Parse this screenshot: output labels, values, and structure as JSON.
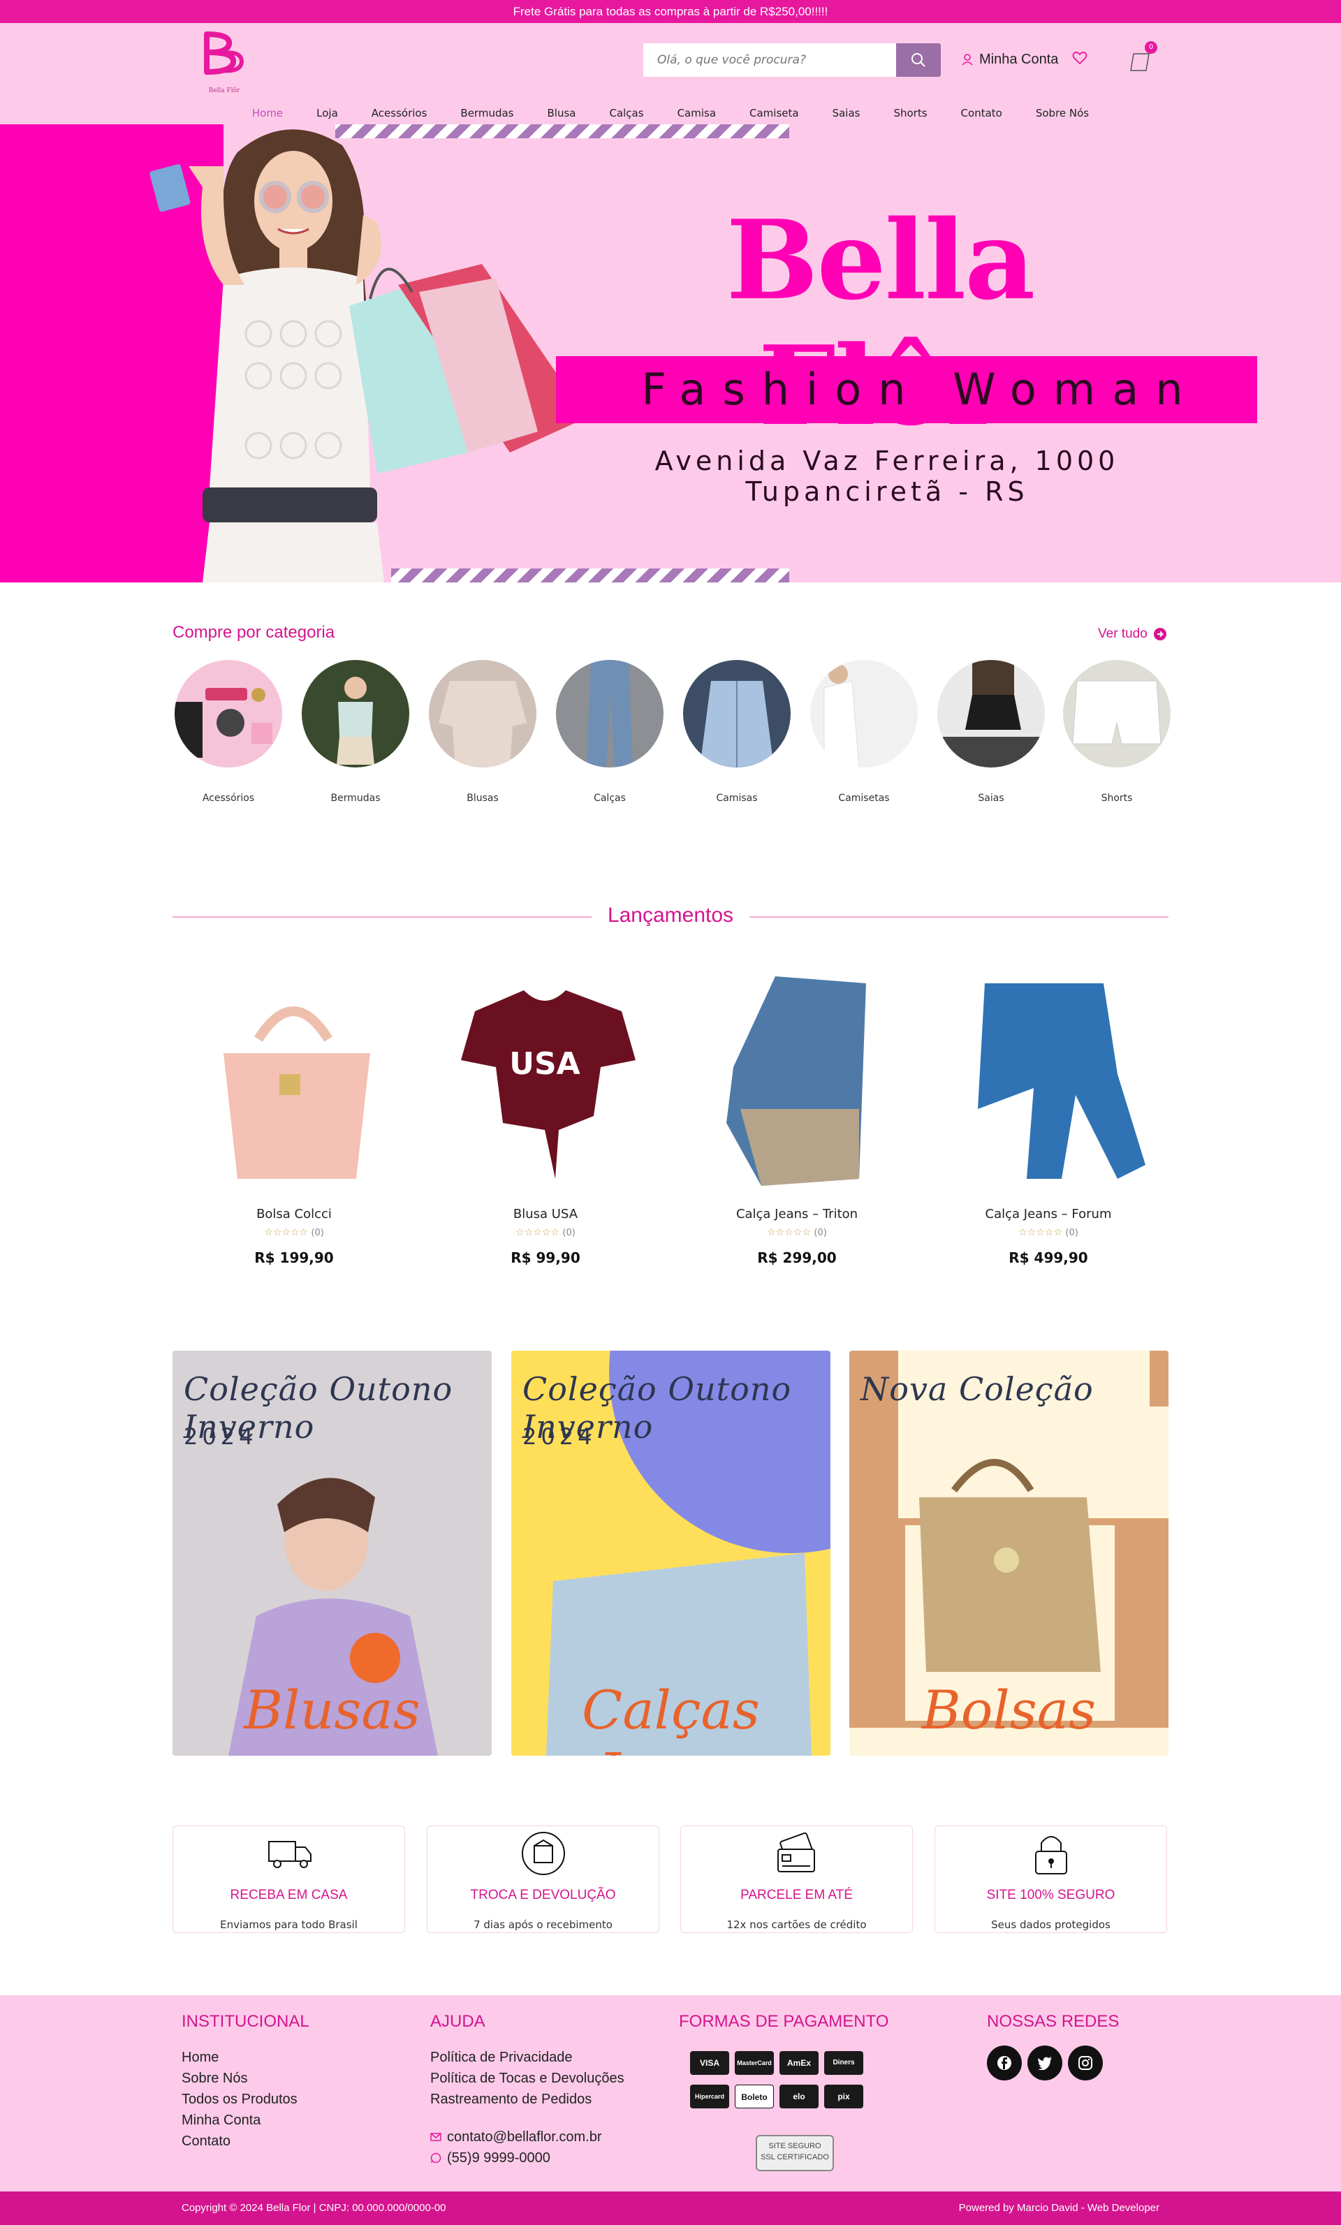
{
  "topbar": {
    "text": "Frete Grátis para todas as compras à partir de R$250,00!!!!!"
  },
  "header": {
    "logo_mark": "B",
    "logo_sub": "Bella Flôr",
    "search_placeholder": "Olá, o que você procura?",
    "account_label": "Minha Conta",
    "cart_count": "0"
  },
  "nav": {
    "items": [
      "Home",
      "Loja",
      "Acessórios",
      "Bermudas",
      "Blusa",
      "Calças",
      "Camisa",
      "Camiseta",
      "Saias",
      "Shorts",
      "Contato",
      "Sobre Nós"
    ],
    "active": "Home"
  },
  "hero": {
    "title": "Bella Flôr",
    "subtitle": "Fashion Woman",
    "address_line1": "Avenida Vaz Ferreira, 1000",
    "address_line2": "Tupanciretã - RS"
  },
  "categories": {
    "title": "Compre por categoria",
    "see_all": "Ver tudo",
    "items": [
      "Acessórios",
      "Bermudas",
      "Blusas",
      "Calças",
      "Camisas",
      "Camisetas",
      "Saias",
      "Shorts"
    ]
  },
  "launches": {
    "title": "Lançamentos",
    "products": [
      {
        "name": "Bolsa Colcci",
        "rating_count": "(0)",
        "price": "R$ 199,90"
      },
      {
        "name": "Blusa USA",
        "rating_count": "(0)",
        "price": "R$ 99,90"
      },
      {
        "name": "Calça Jeans – Triton",
        "rating_count": "(0)",
        "price": "R$ 299,00"
      },
      {
        "name": "Calça Jeans – Forum",
        "rating_count": "(0)",
        "price": "R$ 499,90"
      }
    ]
  },
  "collections": [
    {
      "heading": "Coleção Outono Inverno",
      "year": "2024",
      "caption": "Blusas"
    },
    {
      "heading": "Coleção Outono Inverno",
      "year": "2024",
      "caption": "Calças Jeans"
    },
    {
      "heading": "Nova Coleção",
      "year": "",
      "caption": "Bolsas"
    }
  ],
  "features": [
    {
      "icon": "truck-icon",
      "title": "RECEBA EM CASA",
      "desc": "Enviamos para todo Brasil"
    },
    {
      "icon": "box-return-icon",
      "title": "TROCA E DEVOLUÇÃO",
      "desc": "7 dias após o recebimento"
    },
    {
      "icon": "credit-card-icon",
      "title": "PARCELE EM ATÉ",
      "desc": "12x nos cartões de crédito"
    },
    {
      "icon": "padlock-icon",
      "title": "SITE 100% SEGURO",
      "desc": "Seus dados protegidos"
    }
  ],
  "footer": {
    "institutional": {
      "title": "INSTITUCIONAL",
      "links": [
        "Home",
        "Sobre Nós",
        "Todos os Produtos",
        "Minha Conta",
        "Contato"
      ]
    },
    "help": {
      "title": "AJUDA",
      "links": [
        "Política de Privacidade",
        "Política de Tocas e Devoluções",
        "Rastreamento de Pedidos"
      ],
      "email": "contato@bellaflor.com.br",
      "phone": "(55)9 9999-0000"
    },
    "payments": {
      "title": "FORMAS DE PAGAMENTO",
      "methods": [
        "VISA",
        "MasterCard",
        "AmEx",
        "Diners",
        "Hipercard",
        "Boleto",
        "elo",
        "pix"
      ],
      "ssl_label": "SITE SEGURO",
      "ssl_sub": "SSL CERTIFICADO"
    },
    "social": {
      "title": "NOSSAS REDES",
      "networks": [
        "facebook-icon",
        "twitter-icon",
        "instagram-icon"
      ]
    }
  },
  "bottombar": {
    "copyright": "Copyright © 2024 Bella Flor | CNPJ: 00.000.000/0000-00",
    "powered": "Powered by Marcio David - Web Developer"
  },
  "colors": {
    "brand_pink": "#e8189e",
    "hero_pink": "#ff00b4",
    "soft_pink": "#fdcbe9",
    "accent_purple": "#9a6fa5"
  }
}
